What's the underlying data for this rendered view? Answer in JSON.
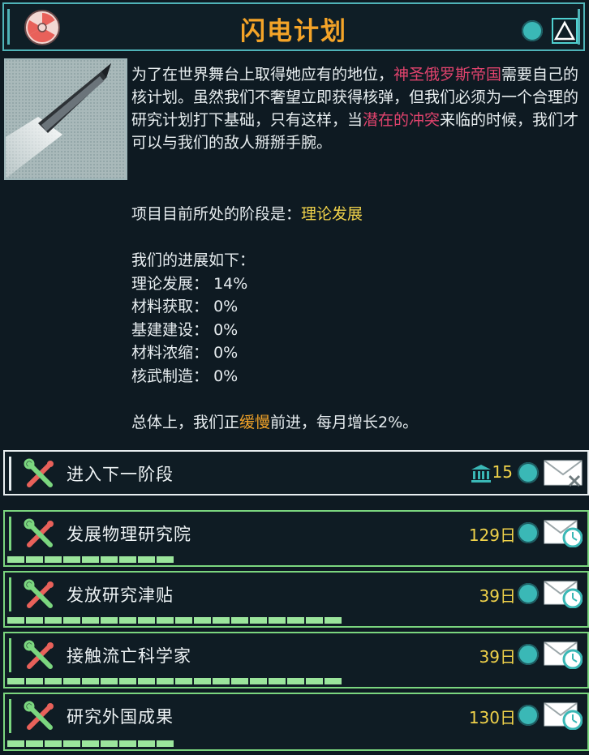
{
  "header": {
    "title": "闪电计划",
    "icon": "radiation-icon",
    "colors": {
      "title": "#f4a428",
      "border": "#4fb3b8",
      "accent": "#3ab8b6"
    }
  },
  "description": {
    "p1_a": "为了在世界舞台上取得她应有的地位，",
    "p1_hl1": "神圣俄罗斯帝国",
    "p1_b": "需要自己的核计划。虽然我们不奢望立即获得核弹，但我们必须为一个合理的研究计划打下基础，只有这样，当",
    "p1_hl2": "潜在的冲突",
    "p1_c": "来临的时候，我们才可以与我们的敌人掰掰手腕。"
  },
  "stage": {
    "label": "项目目前所处的阶段是：",
    "value": "理论发展"
  },
  "progress": {
    "heading": "我们的进展如下：",
    "items": [
      {
        "label": "理论发展：",
        "value": "14%"
      },
      {
        "label": "材料获取：",
        "value": "0%"
      },
      {
        "label": "基建建设：",
        "value": "0%"
      },
      {
        "label": "材料浓缩：",
        "value": "0%"
      },
      {
        "label": "核武制造：",
        "value": "0%"
      }
    ]
  },
  "summary": {
    "a": "总体上，我们正",
    "speed": "缓慢",
    "b": "前进，每月增长2%。"
  },
  "actions": [
    {
      "label": "进入下一阶段",
      "cost": "15",
      "cost_icon": "bank-icon",
      "type": "next",
      "progress": null
    },
    {
      "label": "发展物理研究院",
      "cost": "129日",
      "type": "project",
      "progress": 0.29
    },
    {
      "label": "发放研究津贴",
      "cost": "39日",
      "type": "project",
      "progress": 0.58
    },
    {
      "label": "接触流亡科学家",
      "cost": "39日",
      "type": "project",
      "progress": 0.58
    },
    {
      "label": "研究外国成果",
      "cost": "130日",
      "type": "project",
      "progress": 0.29
    }
  ]
}
